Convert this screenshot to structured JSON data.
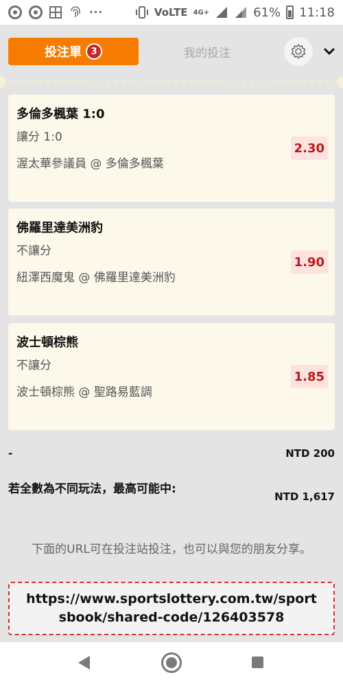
{
  "status_bar": {
    "battery": "61%",
    "time": "11:18",
    "network": "4G+",
    "volte": "VoLTE"
  },
  "header": {
    "betslip_tab": "投注單",
    "betslip_count": "3",
    "my_bets_tab": "我的投注"
  },
  "bets": [
    {
      "title": "多倫多楓葉 1:0",
      "market": "讓分 1:0",
      "match": "渥太華參議員 @ 多倫多楓葉",
      "odds": "2.30"
    },
    {
      "title": "佛羅里達美洲豹",
      "market": "不讓分",
      "match": "紐澤西魔鬼 @ 佛羅里達美洲豹",
      "odds": "1.90"
    },
    {
      "title": "波士頓棕熊",
      "market": "不讓分",
      "match": "波士頓棕熊 @ 聖路易藍調",
      "odds": "1.85"
    }
  ],
  "summary": {
    "stake_label": "-",
    "stake_value": "NTD 200",
    "maxwin_label": "若全數為不同玩法，最高可能中:",
    "maxwin_value": "NTD 1,617"
  },
  "share": {
    "note": "下面的URL可在投注站投注，也可以與您的朋友分享。",
    "url": "https://www.sportslottery.com.tw/sportsbook/shared-code/126403578"
  },
  "colors": {
    "accent": "#f57c00",
    "badge": "#c62828",
    "odds_text": "#b71c1c",
    "odds_bg": "#fde2df",
    "card_bg": "#fcf8ea"
  }
}
